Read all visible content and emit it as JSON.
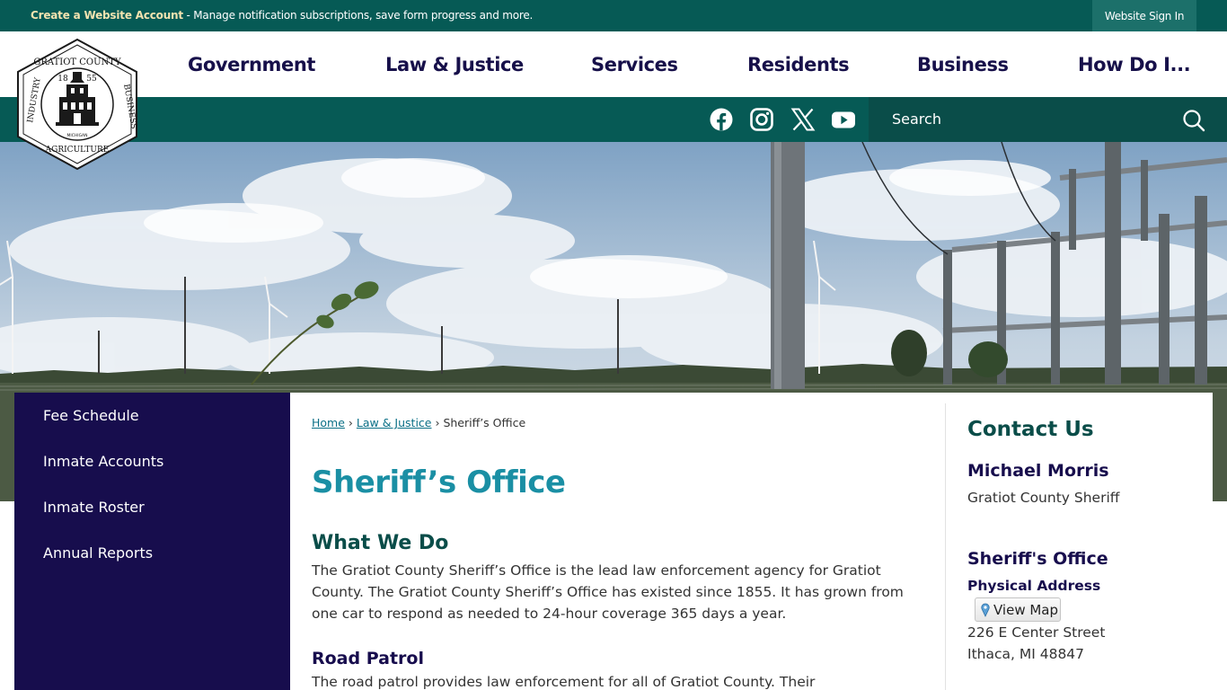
{
  "topbar": {
    "account_link": "Create a Website Account",
    "account_text": " - Manage notification subscriptions, save form progress and more.",
    "signin": "Website Sign In"
  },
  "logo": {
    "top_text": "GRATIOT COUNTY",
    "left_text": "INDUSTRY",
    "right_text": "BUSINESS",
    "bottom_text": "AGRICULTURE",
    "year_left": "18",
    "year_right": "55",
    "state": "MICHIGAN"
  },
  "nav": {
    "items": [
      "Government",
      "Law & Justice",
      "Services",
      "Residents",
      "Business",
      "How Do I..."
    ]
  },
  "social": {
    "icons": [
      "facebook-icon",
      "instagram-icon",
      "x-icon",
      "youtube-icon"
    ]
  },
  "search": {
    "placeholder": "Search"
  },
  "sidebar": {
    "items": [
      "Fee Schedule",
      "Inmate Accounts",
      "Inmate Roster",
      "Annual Reports"
    ]
  },
  "breadcrumb": {
    "home": "Home",
    "sep1": " › ",
    "law": "Law & Justice",
    "sep2": " › ",
    "current": "Sheriff’s Office"
  },
  "main": {
    "title": "Sheriff’s Office",
    "what_we_do_heading": "What We Do",
    "what_we_do_text": "The Gratiot County Sheriff’s Office is the lead law enforcement agency for Gratiot County. The Gratiot County Sheriff’s Office has existed since 1855. It has grown from one car to respond as needed to 24-hour coverage 365 days a year.",
    "road_patrol_heading": "Road Patrol",
    "road_patrol_text": "The road patrol provides law enforcement for all of Gratiot County. Their"
  },
  "contact": {
    "title": "Contact Us",
    "name": "Michael Morris",
    "role": "Gratiot County Sheriff",
    "office": "Sheriff's Office",
    "address_label": "Physical Address",
    "view_map": "View Map",
    "street": "226 E Center Street",
    "city": "Ithaca, MI 48847"
  },
  "colors": {
    "top_green": "#065a55",
    "navy": "#170d4d",
    "teal_title": "#1a8fa4"
  }
}
